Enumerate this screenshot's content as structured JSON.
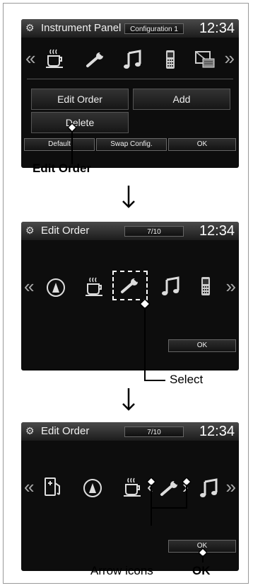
{
  "screen1": {
    "title": "Instrument Panel",
    "badge": "Configuration 1",
    "time": "12:34",
    "buttons": {
      "edit_order": "Edit Order",
      "add": "Add",
      "delete": "Delete"
    },
    "softkeys": {
      "default": "Default",
      "swap": "Swap Config.",
      "ok": "OK"
    },
    "icons": [
      "coffee-icon",
      "wrench-icon",
      "music-icon",
      "phone-icon",
      "map-message-icon"
    ]
  },
  "callout1": "Edit Order",
  "screen2": {
    "title": "Edit Order",
    "badge": "7/10",
    "time": "12:34",
    "ok": "OK",
    "icons": [
      "gauge-icon",
      "coffee-icon",
      "wrench-icon",
      "music-icon",
      "phone-icon"
    ]
  },
  "callout2": "Select",
  "screen3": {
    "title": "Edit Order",
    "badge": "7/10",
    "time": "12:34",
    "ok": "OK",
    "icons": [
      "fuel-icon",
      "gauge-icon",
      "coffee-icon",
      "wrench-icon",
      "music-icon"
    ]
  },
  "callout3": {
    "arrows": "Arrow icons",
    "ok": "OK"
  }
}
